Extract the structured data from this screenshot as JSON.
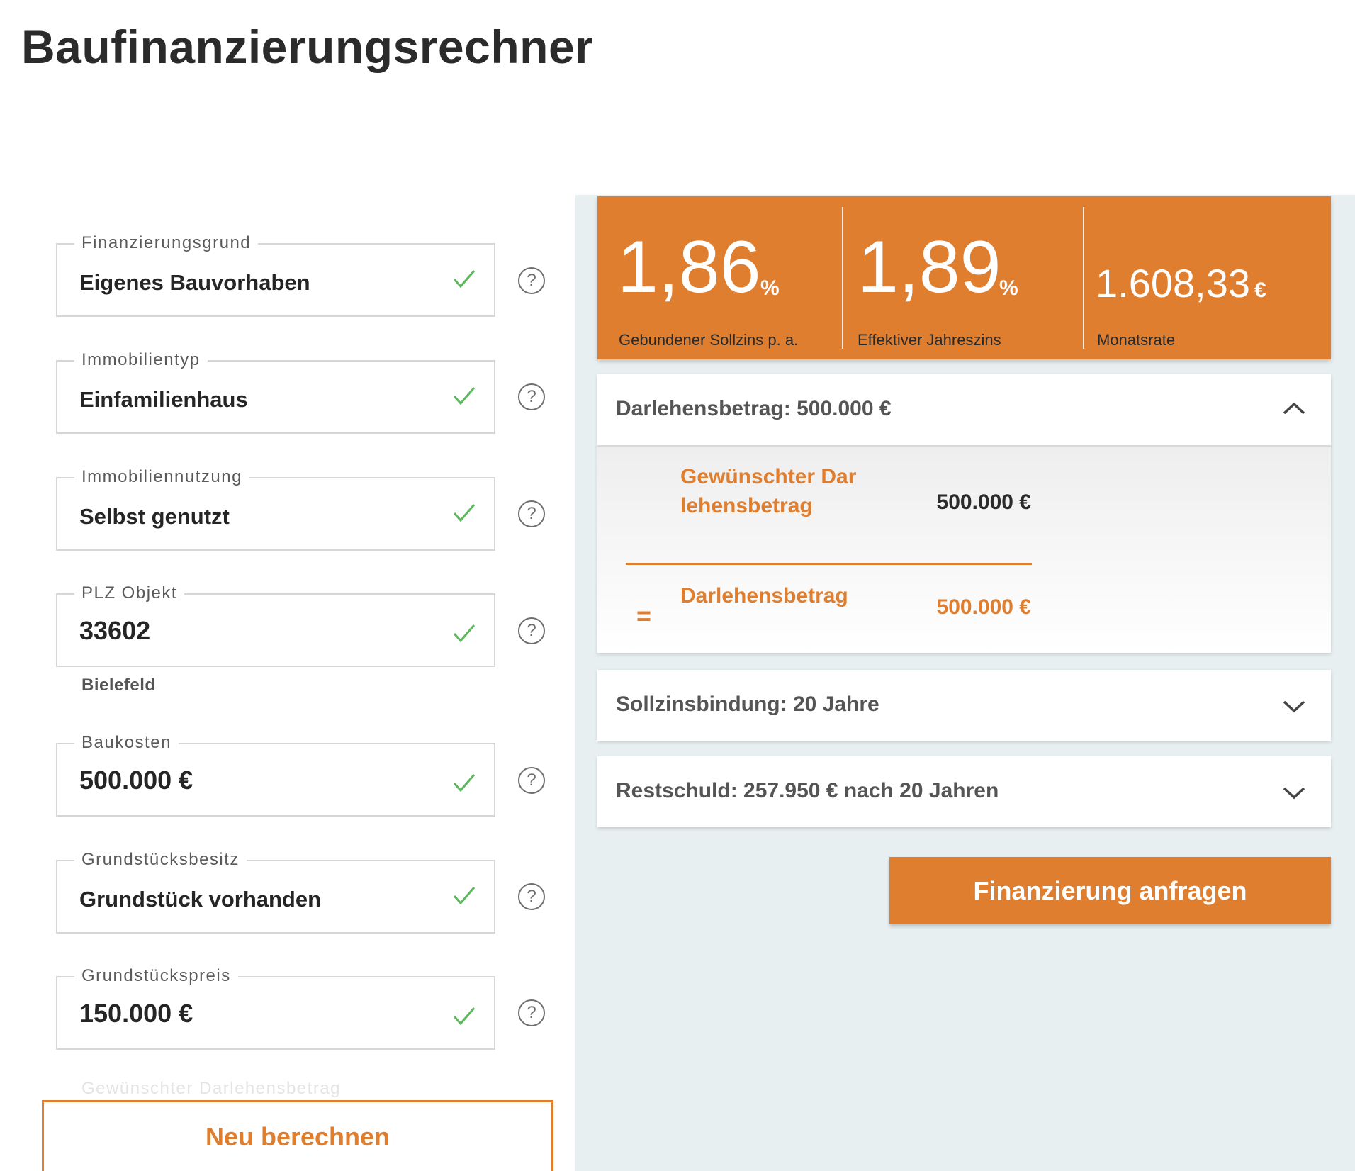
{
  "page": {
    "title": "Baufinanzierungsrechner"
  },
  "form": {
    "fields": [
      {
        "label": "Finanzierungsgrund",
        "value": "Eigenes Bauvorhaben"
      },
      {
        "label": "Immobilientyp",
        "value": "Einfamilienhaus"
      },
      {
        "label": "Immobiliennutzung",
        "value": "Selbst genutzt"
      },
      {
        "label": "PLZ Objekt",
        "value": "33602",
        "sub": "Bielefeld"
      },
      {
        "label": "Baukosten",
        "value": "500.000 €"
      },
      {
        "label": "Grundstücksbesitz",
        "value": "Grundstück vorhanden"
      },
      {
        "label": "Grundstückspreis",
        "value": "150.000 €"
      }
    ],
    "next_field_label": "Gewünschter Darlehensbetrag",
    "help_symbol": "?",
    "recalc_label": "Neu berechnen"
  },
  "results": {
    "sollzins": {
      "value": "1,86",
      "unit": "%",
      "label": "Gebundener Sollzins p. a."
    },
    "effektiv": {
      "value": "1,89",
      "unit": "%",
      "label": "Effektiver Jahreszins"
    },
    "rate": {
      "value": "1.608,33",
      "unit": "€",
      "label": "Monatsrate"
    }
  },
  "accordion": {
    "darlehen": {
      "title": "Darlehensbetrag: 500.000 €",
      "expanded": true,
      "rows": [
        {
          "label": "Gewünschter Darlehensbetrag",
          "value": "500.000 €"
        },
        {
          "prefix": "=",
          "label": "Darlehensbetrag",
          "value": "500.000 €"
        }
      ]
    },
    "zinsbindung": {
      "title": "Sollzinsbindung: 20 Jahre",
      "expanded": false
    },
    "restschuld": {
      "title": "Restschuld: 257.950 € nach 20 Jahren",
      "expanded": false
    }
  },
  "cta": {
    "label": "Finanzierung anfragen"
  },
  "colors": {
    "accent": "#df7e2f",
    "check": "#5cb85c",
    "panel_bg": "#e8eff1",
    "text": "#2d2d2d"
  },
  "icons": {
    "check": "check-icon",
    "help": "help-icon",
    "chevron_up": "chevron-up-icon",
    "chevron_down": "chevron-down-icon"
  }
}
